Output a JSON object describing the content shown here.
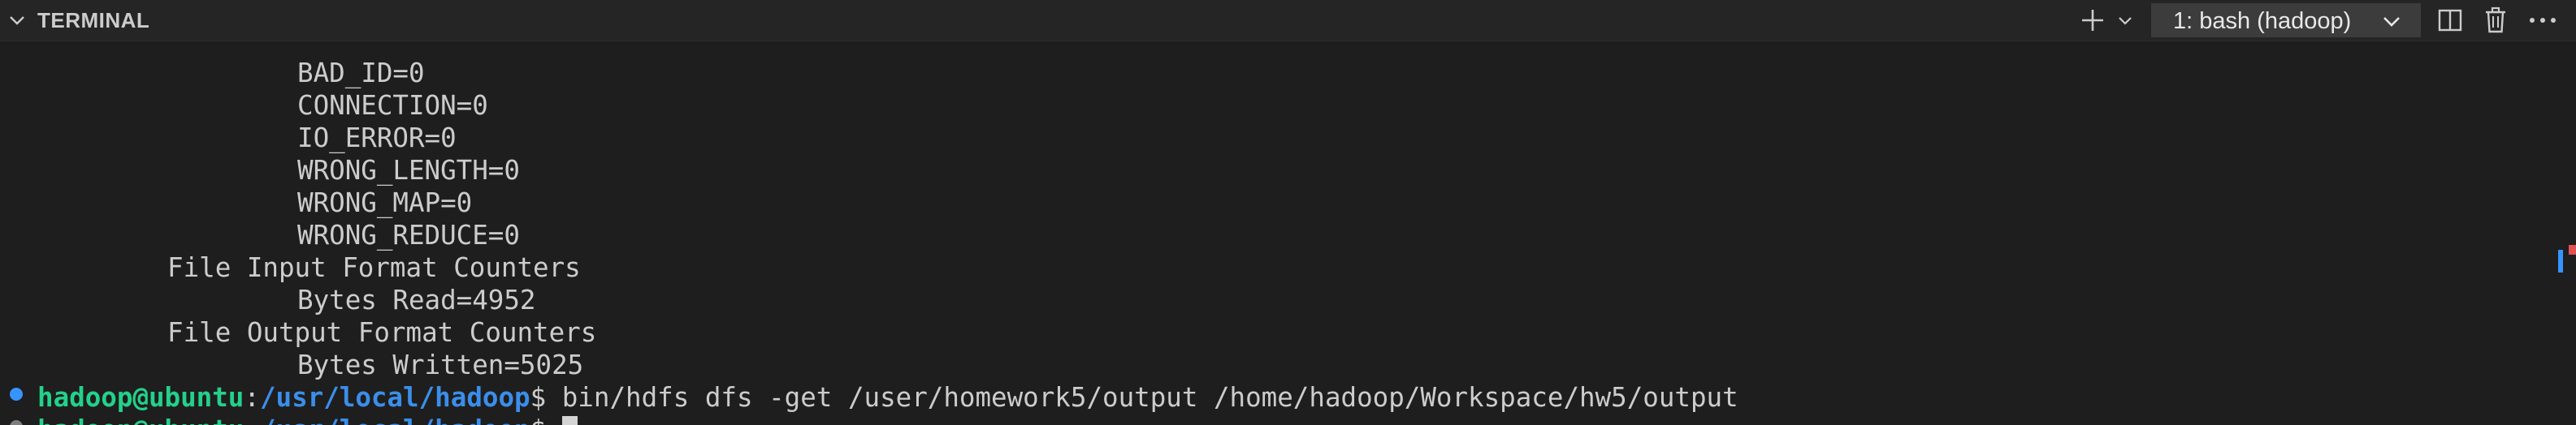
{
  "panel": {
    "title": "TERMINAL",
    "terminal_selector": "1: bash (hadoop)",
    "icons": {
      "collapse": "chevron-down-icon",
      "new_terminal": "plus-icon",
      "new_terminal_dropdown": "chevron-down-icon",
      "split": "split-editor-icon",
      "kill": "trash-icon",
      "more": "ellipsis-icon"
    }
  },
  "terminal": {
    "output_lines": [
      {
        "indent": 2,
        "text": "BAD_ID=0"
      },
      {
        "indent": 2,
        "text": "CONNECTION=0"
      },
      {
        "indent": 2,
        "text": "IO_ERROR=0"
      },
      {
        "indent": 2,
        "text": "WRONG_LENGTH=0"
      },
      {
        "indent": 2,
        "text": "WRONG_MAP=0"
      },
      {
        "indent": 2,
        "text": "WRONG_REDUCE=0"
      },
      {
        "indent": 1,
        "text": "File Input Format Counters"
      },
      {
        "indent": 2,
        "text": "Bytes Read=4952"
      },
      {
        "indent": 1,
        "text": "File Output Format Counters"
      },
      {
        "indent": 2,
        "text": "Bytes Written=5025"
      }
    ],
    "prompts": [
      {
        "user_host": "hadoop@ubuntu",
        "separator": ":",
        "path": "/usr/local/hadoop",
        "dollar": "$",
        "command": " bin/hdfs dfs -get /user/homework5/output /home/hadoop/Workspace/hw5/output"
      },
      {
        "user_host": "hadoop@ubuntu",
        "separator": ":",
        "path": "/usr/local/hadoop",
        "dollar": "$",
        "command": " "
      }
    ]
  },
  "colors": {
    "background": "#1e1e1e",
    "header_background": "#252526",
    "prompt_user": "#23d18b",
    "prompt_path": "#3b8eea",
    "decoration_dot": "#3794ff"
  }
}
